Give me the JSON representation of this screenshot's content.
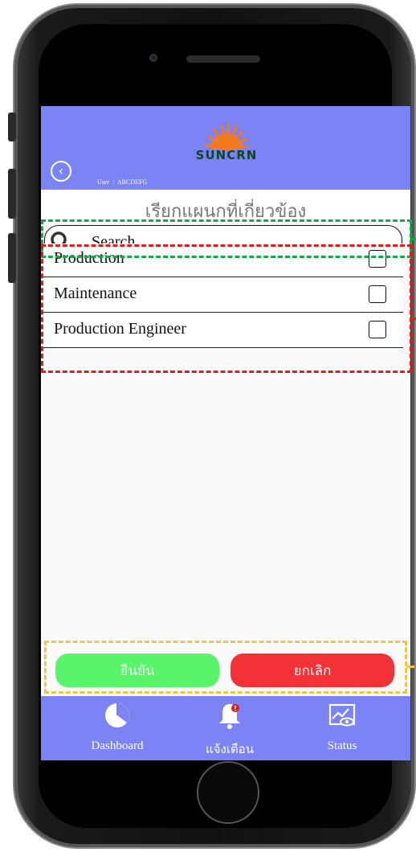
{
  "header": {
    "logo_text": "SUNCRN",
    "user_label": "User  :  ABCDEFG"
  },
  "page": {
    "title": "เรียกแผนกที่เกี่ยวข้อง"
  },
  "search": {
    "placeholder": "Search",
    "value": ""
  },
  "departments": [
    {
      "label": "Production",
      "checked": false
    },
    {
      "label": "Maintenance",
      "checked": false
    },
    {
      "label": "Production Engineer",
      "checked": false
    }
  ],
  "actions": {
    "confirm_label": "ยืนยัน",
    "cancel_label": "ยกเลิก"
  },
  "nav": {
    "items": [
      {
        "label": "Dashboard",
        "icon": "pie-chart-icon"
      },
      {
        "label": "แจ้งเตือน",
        "icon": "bell-alert-icon"
      },
      {
        "label": "Status",
        "icon": "chart-eye-icon"
      }
    ]
  },
  "colors": {
    "header_bg": "#7b83f5",
    "confirm": "#58f56b",
    "cancel": "#f23236",
    "logo_sun": "#f47a20",
    "logo_text": "#0a4a1a"
  }
}
